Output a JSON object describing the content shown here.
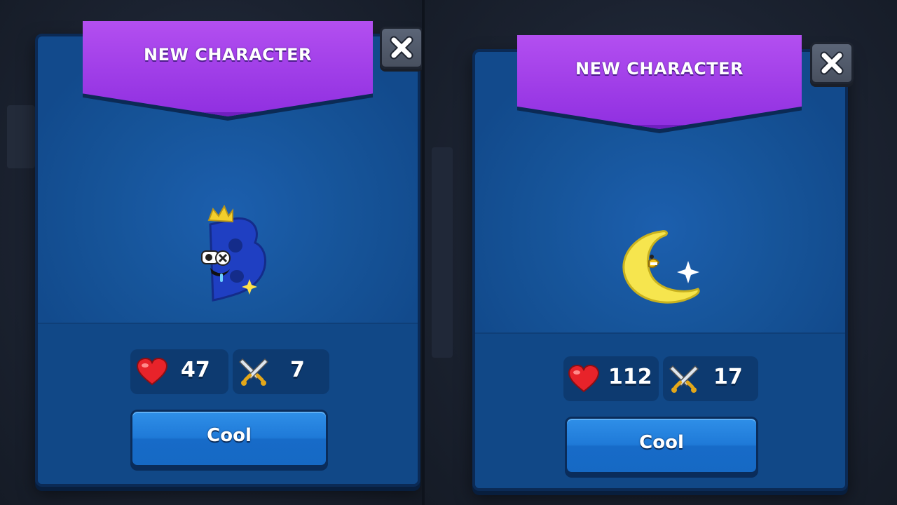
{
  "left_panel": {
    "banner_title": "NEW CHARACTER",
    "close_icon": "close-x-icon",
    "character": "blue-letter-b-with-crown",
    "health": "47",
    "attack": "7",
    "confirm_label": "Cool"
  },
  "right_panel": {
    "banner_title": "NEW CHARACTER",
    "close_icon": "close-x-icon",
    "character": "yellow-crescent-moon",
    "health": "112",
    "attack": "17",
    "confirm_label": "Cool"
  },
  "colors": {
    "panel": "#124a8c",
    "banner": "#9b37e6",
    "button": "#1f7ad8",
    "stat_bg": "#0d3a70"
  }
}
